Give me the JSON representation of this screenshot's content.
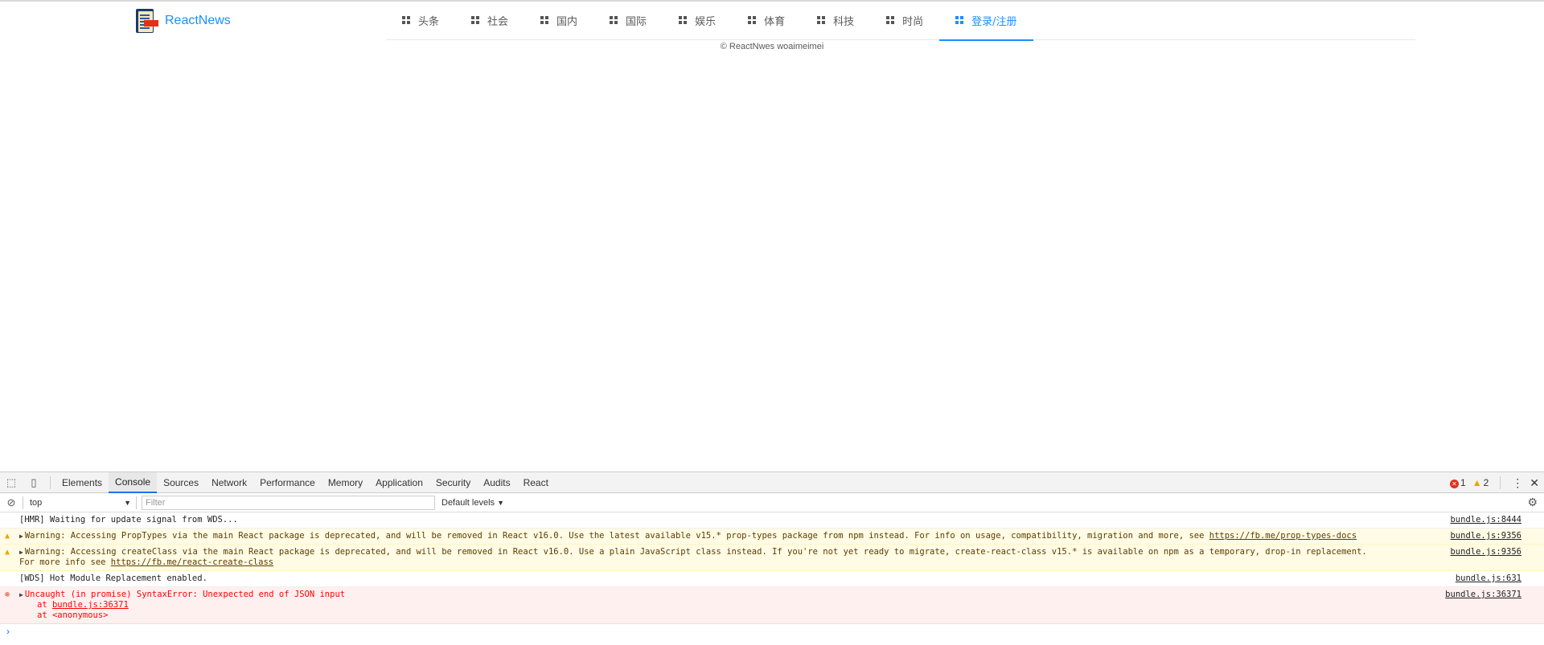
{
  "header": {
    "logo_text": "ReactNews",
    "nav": [
      {
        "label": "头条",
        "active": false
      },
      {
        "label": "社会",
        "active": false
      },
      {
        "label": "国内",
        "active": false
      },
      {
        "label": "国际",
        "active": false
      },
      {
        "label": "娱乐",
        "active": false
      },
      {
        "label": "体育",
        "active": false
      },
      {
        "label": "科技",
        "active": false
      },
      {
        "label": "时尚",
        "active": false
      },
      {
        "label": "登录/注册",
        "active": true
      }
    ],
    "accent_color": "#1890ff"
  },
  "footer": {
    "text": "© ReactNwes woaimeimei"
  },
  "devtools": {
    "tabs": [
      "Elements",
      "Console",
      "Sources",
      "Network",
      "Performance",
      "Memory",
      "Application",
      "Security",
      "Audits",
      "React"
    ],
    "active_tab": "Console",
    "error_count": "1",
    "warning_count": "2",
    "context": "top",
    "filter_placeholder": "Filter",
    "levels": "Default levels",
    "messages": [
      {
        "type": "info",
        "text": "[HMR] Waiting for update signal from WDS...",
        "source": "bundle.js:8444"
      },
      {
        "type": "warn",
        "text": "Warning: Accessing PropTypes via the main React package is deprecated, and will be removed in  React v16.0. Use the latest available v15.* prop-types package from npm instead. For info on usage, compatibility, migration and more, see ",
        "link": "https://fb.me/prop-types-docs",
        "source": "bundle.js:9356"
      },
      {
        "type": "warn",
        "text": "Warning: Accessing createClass via the main React package is deprecated, and will be removed in React v16.0. Use a plain JavaScript class instead. If you're not yet ready to migrate, create-react-class v15.* is available on npm as a temporary, drop-in replacement.",
        "text2": "For more info see ",
        "link": "https://fb.me/react-create-class",
        "source": "bundle.js:9356"
      },
      {
        "type": "info",
        "text": "[WDS] Hot Module Replacement enabled.",
        "source": "bundle.js:631"
      },
      {
        "type": "error",
        "text": "Uncaught (in promise) SyntaxError: Unexpected end of JSON input",
        "stack1_prefix": "at ",
        "stack1_link": "bundle.js:36371",
        "stack2": "at <anonymous>",
        "source": "bundle.js:36371"
      }
    ]
  }
}
